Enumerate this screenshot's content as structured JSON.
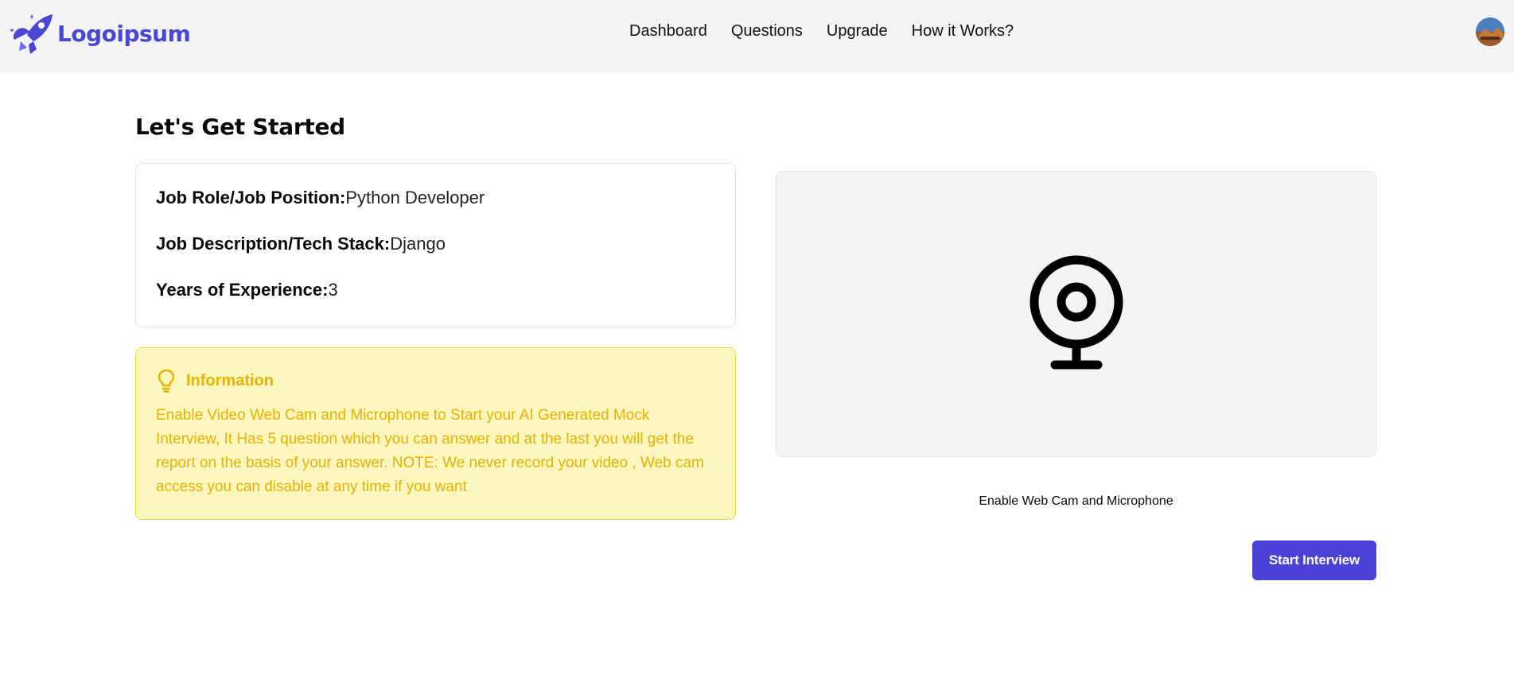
{
  "header": {
    "logo_text": "Logoipsum",
    "brand_color": "#4a46d6",
    "nav": [
      {
        "label": "Dashboard"
      },
      {
        "label": "Questions"
      },
      {
        "label": "Upgrade"
      },
      {
        "label": "How it Works?"
      }
    ]
  },
  "main": {
    "title": "Let's Get Started",
    "details": {
      "job_role_label": "Job Role/Job Position:",
      "job_role_value": "Python Developer",
      "job_desc_label": "Job Description/Tech Stack:",
      "job_desc_value": "Django",
      "experience_label": "Years of Experience:",
      "experience_value": "3"
    },
    "info": {
      "icon": "lightbulb-icon",
      "title": "Information",
      "text": "Enable Video Web Cam and Microphone to Start your AI Generated Mock Interview, It Has 5 question which you can answer and at the last you will get the report on the basis of your answer. NOTE: We never record your video , Web cam access you can disable at any time if you want",
      "color": "#e6b300",
      "background": "#fdf6bf"
    },
    "webcam": {
      "icon": "webcam-icon",
      "enable_label": "Enable Web Cam and Microphone"
    },
    "start_button_label": "Start Interview",
    "accent_color": "#4a42d6"
  }
}
